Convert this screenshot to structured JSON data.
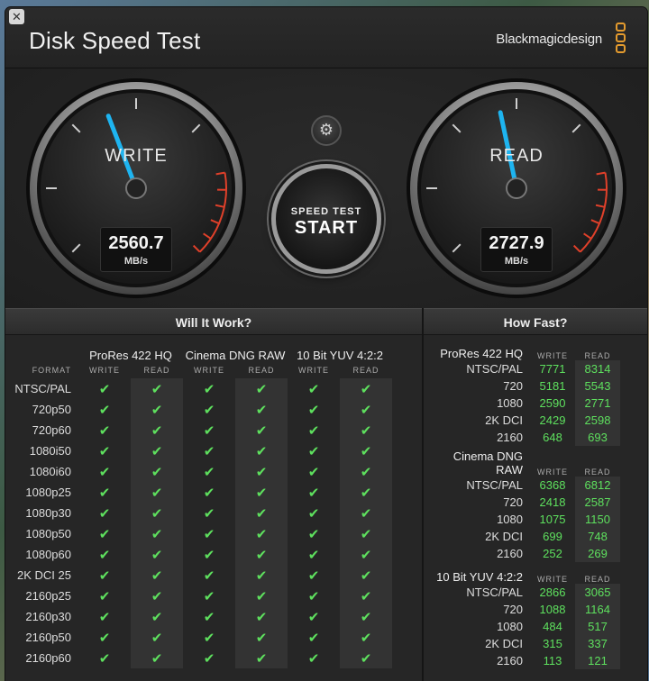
{
  "window": {
    "title": "Disk Speed Test",
    "brand": "Blackmagicdesign",
    "close_glyph": "✕"
  },
  "gauges": {
    "write": {
      "label": "WRITE",
      "value": "2560.7",
      "unit": "MB/s"
    },
    "read": {
      "label": "READ",
      "value": "2727.9",
      "unit": "MB/s"
    }
  },
  "controls": {
    "settings_glyph": "⚙",
    "start_top": "SPEED TEST",
    "start_main": "START"
  },
  "will_it_work": {
    "title": "Will It Work?",
    "format_header": "FORMAT",
    "write_label": "WRITE",
    "read_label": "READ",
    "groups": [
      "ProRes 422 HQ",
      "Cinema DNG RAW",
      "10 Bit YUV 4:2:2"
    ],
    "check_glyph": "✔",
    "formats": [
      "NTSC/PAL",
      "720p50",
      "720p60",
      "1080i50",
      "1080i60",
      "1080p25",
      "1080p30",
      "1080p50",
      "1080p60",
      "2K DCI 25",
      "2160p25",
      "2160p30",
      "2160p50",
      "2160p60"
    ]
  },
  "how_fast": {
    "title": "How Fast?",
    "write_label": "WRITE",
    "read_label": "READ",
    "sections": [
      {
        "name": "ProRes 422 HQ",
        "rows": [
          {
            "format": "NTSC/PAL",
            "write": "7771",
            "read": "8314"
          },
          {
            "format": "720",
            "write": "5181",
            "read": "5543"
          },
          {
            "format": "1080",
            "write": "2590",
            "read": "2771"
          },
          {
            "format": "2K DCI",
            "write": "2429",
            "read": "2598"
          },
          {
            "format": "2160",
            "write": "648",
            "read": "693"
          }
        ]
      },
      {
        "name": "Cinema DNG RAW",
        "rows": [
          {
            "format": "NTSC/PAL",
            "write": "6368",
            "read": "6812"
          },
          {
            "format": "720",
            "write": "2418",
            "read": "2587"
          },
          {
            "format": "1080",
            "write": "1075",
            "read": "1150"
          },
          {
            "format": "2K DCI",
            "write": "699",
            "read": "748"
          },
          {
            "format": "2160",
            "write": "252",
            "read": "269"
          }
        ]
      },
      {
        "name": "10 Bit YUV 4:2:2",
        "rows": [
          {
            "format": "NTSC/PAL",
            "write": "2866",
            "read": "3065"
          },
          {
            "format": "720",
            "write": "1088",
            "read": "1164"
          },
          {
            "format": "1080",
            "write": "484",
            "read": "517"
          },
          {
            "format": "2K DCI",
            "write": "315",
            "read": "337"
          },
          {
            "format": "2160",
            "write": "113",
            "read": "121"
          }
        ]
      }
    ]
  },
  "colors": {
    "accent_needle": "#1eb4f0",
    "ok_green": "#5ee05e",
    "redline": "#e0402a",
    "brand_orange": "#e49b2e"
  }
}
